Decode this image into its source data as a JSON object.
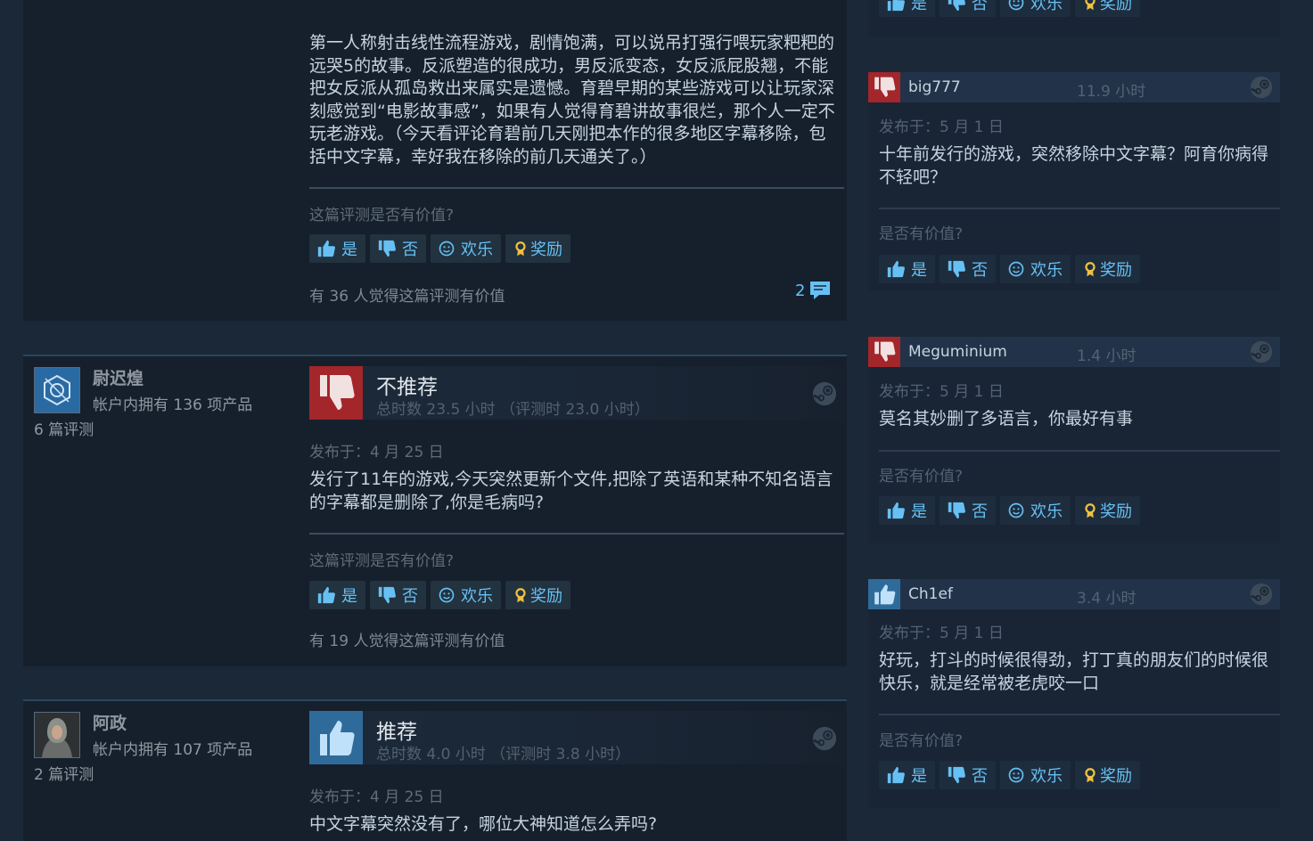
{
  "reviews": [
    {
      "text": "第一人称射击线性流程游戏，剧情饱满，可以说吊打强行喂玩家粑粑的远哭5的故事。反派塑造的很成功，男反派变态，女反派屁股翘，不能把女反派从孤岛救出来属实是遗憾。育碧早期的某些游戏可以让玩家深刻感觉到“电影故事感”，如果有人觉得育碧讲故事很烂，那个人一定不玩老游戏。（今天看评论育碧前几天刚把本作的很多地区字幕移除，包括中文字幕，幸好我在移除的前几天通关了。）",
      "helpful_question": "这篇评测是否有价值?",
      "helpful_count": "有 36 人觉得这篇评测有价值",
      "comment_count": "2"
    },
    {
      "user": {
        "name": "尉迟煌",
        "products": "帐户内拥有 136 项产品",
        "reviews": "6 篇评测"
      },
      "verdict": "不推荐",
      "hours": "总时数 23.5 小时  （评测时 23.0 小时）",
      "posted": "发布于：4 月 25 日",
      "text": "发行了11年的游戏,今天突然更新个文件,把除了英语和某种不知名语言的字幕都是删除了,你是毛病吗?",
      "helpful_question": "这篇评测是否有价值?",
      "helpful_count": "有 19 人觉得这篇评测有价值"
    },
    {
      "user": {
        "name": "阿政",
        "products": "帐户内拥有 107 项产品",
        "reviews": "2 篇评测"
      },
      "verdict": "推荐",
      "hours": "总时数 4.0 小时  （评测时 3.8 小时）",
      "posted": "发布于：4 月 25 日",
      "text": "中文字幕突然没有了，哪位大神知道怎么弄吗?"
    }
  ],
  "votes": {
    "yes": "是",
    "no": "否",
    "funny": "欢乐",
    "award": "奖励"
  },
  "recent": [
    {
      "name": "big777",
      "hours": "11.9 小时",
      "posted": "发布于：5 月 1 日",
      "recommended": false,
      "text": "十年前发行的游戏，突然移除中文字幕？阿育你病得不轻吧？",
      "question": "是否有价值?"
    },
    {
      "name": "Meguminium",
      "hours": "1.4 小时",
      "posted": "发布于：5 月 1 日",
      "recommended": false,
      "text": "莫名其妙删了多语言，你最好有事",
      "question": "是否有价值?"
    },
    {
      "name": "Ch1ef",
      "hours": "3.4 小时",
      "posted": "发布于：5 月 1 日",
      "recommended": true,
      "text": "好玩，打斗的时候很得劲，打丁真的朋友们的时候很快乐，就是经常被老虎咬一口",
      "question": "是否有价值?"
    }
  ],
  "colors": {
    "accent": "#66c0f4",
    "negative": "#a3262a",
    "positive": "#2f6b9a",
    "award": "#f0c140"
  },
  "icons": [
    "thumbs-up-icon",
    "thumbs-down-icon",
    "smiley-icon",
    "award-icon",
    "steam-logo-icon",
    "comment-icon"
  ]
}
